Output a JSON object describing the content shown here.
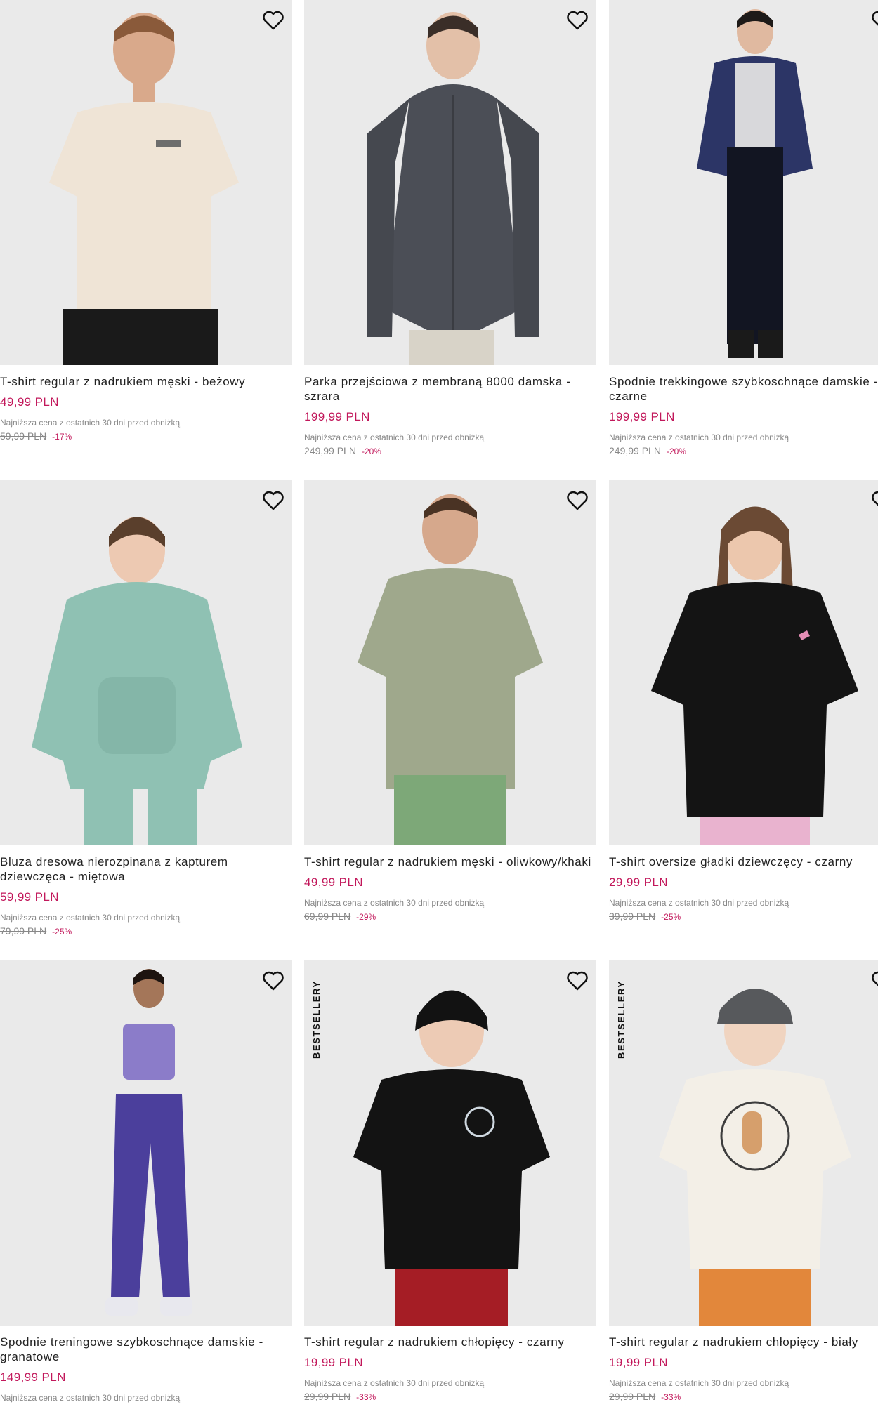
{
  "colors": {
    "price": "#c2185b",
    "muted": "#888888",
    "image_bg": "#eaeaea"
  },
  "lowest_price_note": "Najniższa cena z ostatnich 30 dni przed obniżką",
  "products": [
    {
      "title": "T-shirt regular z nadrukiem męski - beżowy",
      "price": "49,99 PLN",
      "old_price": "59,99 PLN",
      "discount": "-17%",
      "badge": "",
      "icon": "heart-icon"
    },
    {
      "title": "Parka przejściowa z membraną 8000 damska - szrara",
      "price": "199,99 PLN",
      "old_price": "249,99 PLN",
      "discount": "-20%",
      "badge": "",
      "icon": "heart-icon"
    },
    {
      "title": "Spodnie trekkingowe szybkoschnące damskie - czarne",
      "price": "199,99 PLN",
      "old_price": "249,99 PLN",
      "discount": "-20%",
      "badge": "",
      "icon": "heart-icon"
    },
    {
      "title": "Bluza dresowa nierozpinana z kapturem dziewczęca - miętowa",
      "price": "59,99 PLN",
      "old_price": "79,99 PLN",
      "discount": "-25%",
      "badge": "",
      "icon": "heart-icon"
    },
    {
      "title": "T-shirt regular z nadrukiem męski - oliwkowy/khaki",
      "price": "49,99 PLN",
      "old_price": "69,99 PLN",
      "discount": "-29%",
      "badge": "",
      "icon": "heart-icon"
    },
    {
      "title": "T-shirt oversize gładki dziewczęcy - czarny",
      "price": "29,99 PLN",
      "old_price": "39,99 PLN",
      "discount": "-25%",
      "badge": "",
      "icon": "heart-icon"
    },
    {
      "title": "Spodnie treningowe szybkoschnące damskie - granatowe",
      "price": "149,99 PLN",
      "old_price": "",
      "discount": "",
      "badge": "",
      "icon": "heart-icon"
    },
    {
      "title": "T-shirt regular z nadrukiem chłopięcy - czarny",
      "price": "19,99 PLN",
      "old_price": "29,99 PLN",
      "discount": "-33%",
      "badge": "BESTSELLERY",
      "icon": "heart-icon"
    },
    {
      "title": "T-shirt regular z nadrukiem chłopięcy - biały",
      "price": "19,99 PLN",
      "old_price": "29,99 PLN",
      "discount": "-33%",
      "badge": "BESTSELLERY",
      "icon": "heart-icon"
    }
  ]
}
